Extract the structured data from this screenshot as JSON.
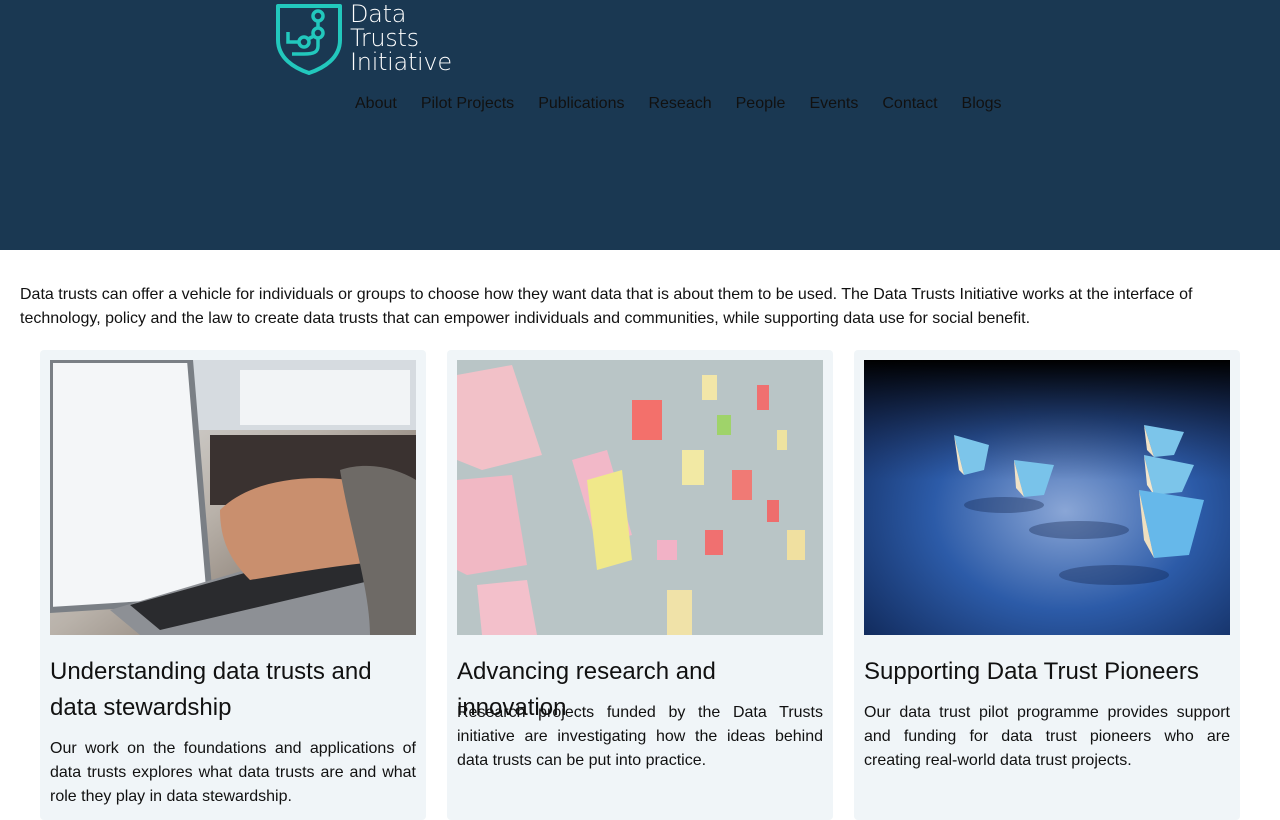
{
  "logo": {
    "line1": "Data",
    "line2": "Trusts",
    "line3": "Initiative"
  },
  "nav": {
    "items": [
      "About",
      "Pilot Projects",
      "Publications",
      "Reseach",
      "People",
      "Events",
      "Contact",
      "Blogs"
    ]
  },
  "intro": {
    "text": "Data trusts can offer a vehicle for individuals or groups to choose how they want data that is about them to be used. The Data Trusts Initiative works at the interface of technology, policy and the law to create data trusts that can empower individuals and communities, while supporting data use for social benefit."
  },
  "cards": [
    {
      "title": "Understanding data trusts and data stewardship",
      "body": "Our work on the foundations and applications of data trusts explores what data trusts are and what role they play in data stewardship."
    },
    {
      "title": "Advancing research and innovation",
      "body": "Research projects funded by the Data Trusts initiative are investigating how the ideas behind data trusts can be put into practice."
    },
    {
      "title": "Supporting Data Trust Pioneers",
      "body": "Our data trust pilot programme provides support and funding for data trust pioneers who are creating real-world data trust projects."
    }
  ],
  "colors": {
    "header_bg": "#1a3852",
    "logo_accent": "#22c8bd",
    "card_bg": "#f0f5f8"
  }
}
